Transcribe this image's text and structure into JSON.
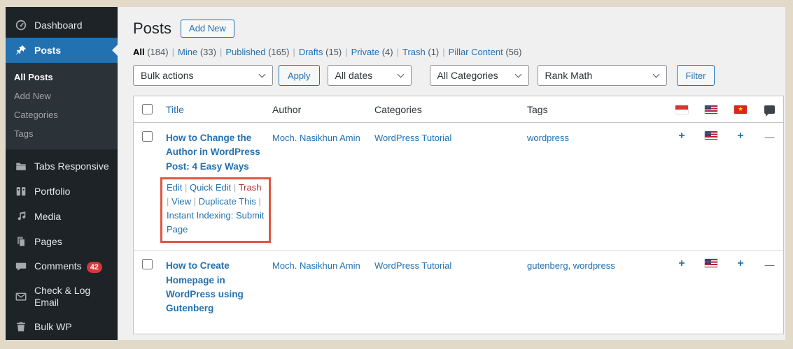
{
  "colors": {
    "accent_blue": "#2271b1",
    "annotation_red": "#e0563f",
    "badge_red": "#d63638",
    "trash_link_red": "#b32d2e",
    "sidebar_bg": "#1d2327",
    "content_bg": "#f0f0f1",
    "frame_beige": "#e2d9c8"
  },
  "sidebar": {
    "items": [
      {
        "label": "Dashboard",
        "icon": "dashboard-icon"
      },
      {
        "label": "Posts",
        "icon": "pushpin-icon",
        "active": true
      },
      {
        "label": "Tabs Responsive",
        "icon": "folder-icon"
      },
      {
        "label": "Portfolio",
        "icon": "portfolio-icon"
      },
      {
        "label": "Media",
        "icon": "media-icon"
      },
      {
        "label": "Pages",
        "icon": "pages-icon"
      },
      {
        "label": "Comments",
        "icon": "comment-icon",
        "badge": "42"
      },
      {
        "label": "Check & Log Email",
        "icon": "envelope-icon"
      },
      {
        "label": "Bulk WP",
        "icon": "trash-icon"
      }
    ],
    "posts_submenu": [
      {
        "label": "All Posts",
        "current": true
      },
      {
        "label": "Add New"
      },
      {
        "label": "Categories"
      },
      {
        "label": "Tags"
      }
    ]
  },
  "page": {
    "title": "Posts",
    "add_new_button": "Add New"
  },
  "status_filters": {
    "separator": "|",
    "items": [
      {
        "label": "All",
        "count": "(184)",
        "current": true
      },
      {
        "label": "Mine",
        "count": "(33)"
      },
      {
        "label": "Published",
        "count": "(165)"
      },
      {
        "label": "Drafts",
        "count": "(15)"
      },
      {
        "label": "Private",
        "count": "(4)"
      },
      {
        "label": "Trash",
        "count": "(1)"
      },
      {
        "label": "Pillar Content",
        "count": "(56)"
      }
    ]
  },
  "toolbar": {
    "bulk_actions": "Bulk actions",
    "apply_button": "Apply",
    "dates_filter": "All dates",
    "categories_filter": "All Categories",
    "seo_filter": "Rank Math",
    "filter_button": "Filter"
  },
  "table": {
    "headers": {
      "title": "Title",
      "author": "Author",
      "categories": "Categories",
      "tags": "Tags"
    },
    "header_icon_columns": [
      "indonesian-flag",
      "us-flag",
      "vietnamese-flag",
      "comment-bubble"
    ],
    "action_separator": "|",
    "rows": [
      {
        "title": "How to Change the Author in WordPress Post: 4 Easy Ways",
        "author": "Moch. Nasikhun Amin",
        "categories": "WordPress Tutorial",
        "tags": "wordpress",
        "actions": [
          {
            "label": "Edit"
          },
          {
            "label": "Quick Edit"
          },
          {
            "label": "Trash",
            "style": "danger"
          },
          {
            "label": "View"
          },
          {
            "label": "Duplicate This"
          },
          {
            "label": "Instant Indexing: Submit Page"
          }
        ],
        "lang_id": "+",
        "lang_vn": "+",
        "comment_count": "—"
      },
      {
        "title": "How to Create Homepage in WordPress using Gutenberg",
        "author": "Moch. Nasikhun Amin",
        "categories": "WordPress Tutorial",
        "tags": "gutenberg, wordpress",
        "lang_id": "+",
        "lang_vn": "+",
        "comment_count": "—"
      }
    ]
  }
}
